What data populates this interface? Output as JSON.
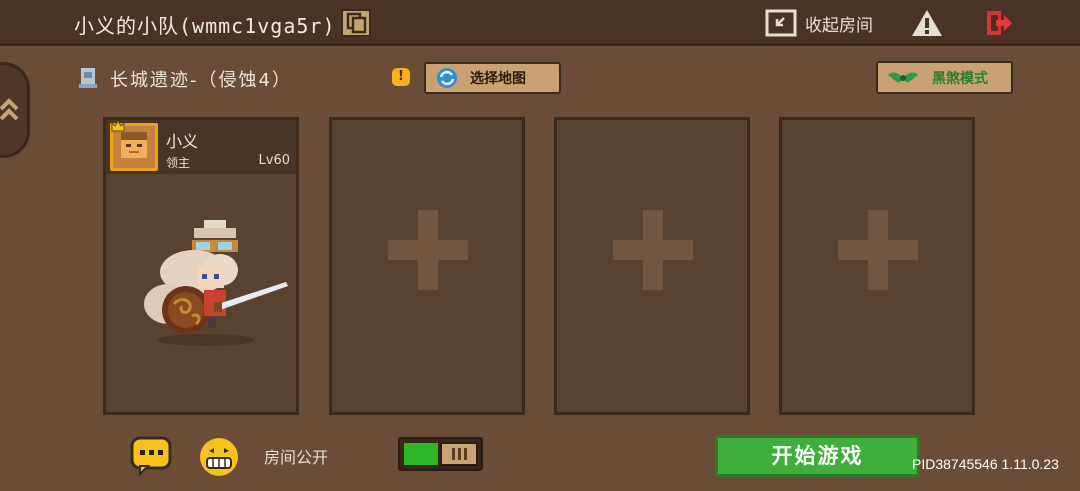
{
  "header": {
    "team_title": "小义的小队(wmmc1vga5r)",
    "collapse_room_label": "收起房间",
    "icons": [
      "copy-icon",
      "collapse-icon",
      "warning-icon",
      "exit-icon"
    ]
  },
  "map": {
    "name": "长城遗迹-（侵蚀4）",
    "select_map_label": "选择地图",
    "dark_mode_label": "黑煞模式",
    "alert_mark": "!"
  },
  "slots": [
    {
      "player_name": "小义",
      "role": "领主",
      "level": "Lv60"
    },
    {
      "empty": true
    },
    {
      "empty": true
    },
    {
      "empty": true
    }
  ],
  "footer": {
    "room_public_label": "房间公开",
    "room_public_enabled": true,
    "start_game_label": "开始游戏",
    "pid_version": "PID38745546 1.11.0.23"
  },
  "colors": {
    "background": "#6b4c36",
    "start_button": "#3fae3b",
    "dark_mode_text": "#2c7d28",
    "avatar_border": "#e8a21d"
  }
}
